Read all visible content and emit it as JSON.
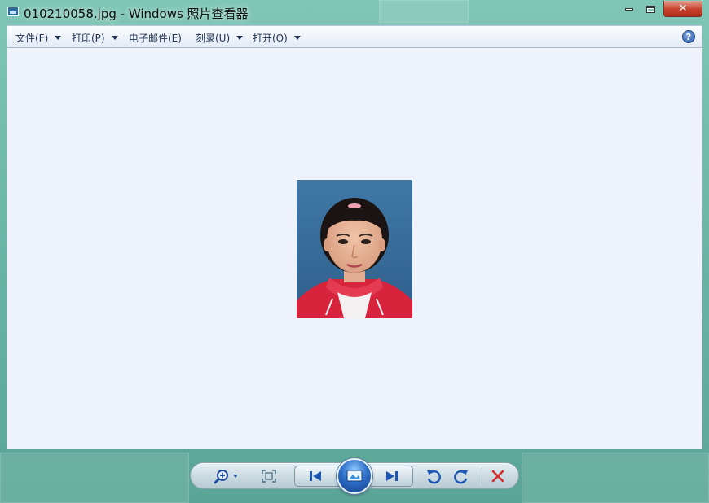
{
  "window": {
    "title": "010210058.jpg - Windows 照片查看器",
    "controls": {
      "minimize": "minimize",
      "maximize": "maximize",
      "close": "✕"
    }
  },
  "menu": {
    "items": [
      {
        "label": "文件(F)",
        "has_dropdown": true
      },
      {
        "label": "打印(P)",
        "has_dropdown": true
      },
      {
        "label": "电子邮件(E)",
        "has_dropdown": false
      },
      {
        "label": "刻录(U)",
        "has_dropdown": true
      },
      {
        "label": "打开(O)",
        "has_dropdown": true
      }
    ],
    "help_icon": "?"
  },
  "viewer": {
    "background_color": "#eef2fa",
    "photo": {
      "description_icon": "portrait-photo"
    }
  },
  "toolbar": {
    "buttons": [
      "zoom-icon",
      "actual-size-icon",
      "previous-icon",
      "slideshow-icon",
      "next-icon",
      "rotate-counterclockwise-icon",
      "rotate-clockwise-icon",
      "delete-icon"
    ]
  },
  "colors": {
    "accent_blue": "#2e6fc8",
    "close_red": "#c7402b",
    "delete_red": "#d42a2a",
    "desktop_green": "#6fb8a8"
  }
}
